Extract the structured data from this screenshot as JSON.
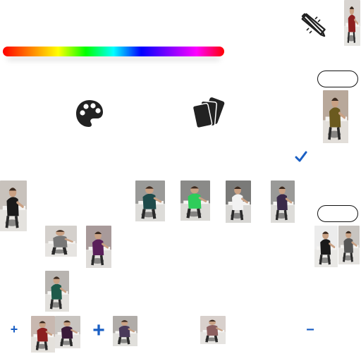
{
  "toolbar": {
    "tools_icon": "pencil-ruler-icon",
    "palette_icon": "palette-icon",
    "cards_icon": "cards-icon",
    "checkmark_icon": "checkmark-icon",
    "plus_symbol": "+",
    "plus_symbol_large": "+",
    "minus_symbol": "−"
  },
  "colors": {
    "accent": "#1a5fc4",
    "icon_dark": "#222222",
    "rainbow": [
      "#ff0000",
      "#ff8000",
      "#ffff00",
      "#00ff00",
      "#00ffff",
      "#0000ff",
      "#8000ff",
      "#ff00ff",
      "#ff0000"
    ]
  },
  "thumbnails": [
    {
      "shirt": "#8c1f1f",
      "bg": "#d8d4d0"
    },
    {
      "shirt": "#6b5a1f",
      "bg": "#b8a89a"
    },
    {
      "shirt": "#1a1a1a",
      "bg": "#c8c2bc"
    },
    {
      "shirt": "#1e4a4a",
      "bg": "#9a9a98"
    },
    {
      "shirt": "#2ecc5a",
      "bg": "#8a8a88"
    },
    {
      "shirt": "#f2f2f2",
      "bg": "#7a7a78"
    },
    {
      "shirt": "#3a2a4a",
      "bg": "#9a9a98"
    },
    {
      "shirt": "#777777",
      "bg": "#d4d0cc"
    },
    {
      "shirt": "#5a1f5a",
      "bg": "#a89a9a"
    },
    {
      "shirt": "#1a1a1a",
      "bg": "#ececec"
    },
    {
      "shirt": "#555555",
      "bg": "#c8c4c0"
    },
    {
      "shirt": "#1e5a4a",
      "bg": "#b8b4b0"
    },
    {
      "shirt": "#8c1f1f",
      "bg": "#c8b8b0"
    },
    {
      "shirt": "#3a1a3a",
      "bg": "#c8c4c0"
    },
    {
      "shirt": "#4a3a5a",
      "bg": "#b0aca8"
    },
    {
      "shirt": "#8c6060",
      "bg": "#d8d0cc"
    }
  ]
}
